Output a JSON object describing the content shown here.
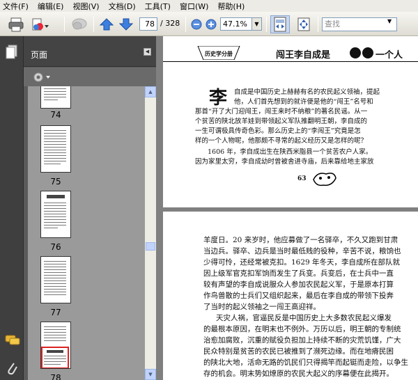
{
  "menu": [
    "文件(F)",
    "编辑(E)",
    "视图(V)",
    "文档(D)",
    "工具(T)",
    "窗口(W)",
    "帮助(H)"
  ],
  "toolbar": {
    "page_current": "78",
    "page_total": "/ 328",
    "zoom": "47.1%",
    "search_placeholder": "查找"
  },
  "panel": {
    "title": "页面",
    "thumb_labels": [
      "74",
      "75",
      "76",
      "77",
      "78"
    ]
  },
  "page1": {
    "header_tag": "历史学分册",
    "header_title": "闯王李自成是",
    "header_title_end": "一个人",
    "dropcap": "李",
    "lines": [
      "自成是中国历史上赫赫有名的农民起义领袖，提起",
      "他，人们首先想到的就许便是他的“闯王”名号和",
      "那首“开了大门迎闯王，闯王来时不纳粮”的著名民谣。从一",
      "个贫苦的陕北放羊娃到带领起义军队推翻明王朝，李自成的",
      "一生可谓极具传奇色彩。那么历史上的“李闯王”究竟是怎",
      "样的一个人物呢，他那颇不寻常的起义经历又是怎样的呢？",
      "1606 年，李自成出生在陕西米脂县一个贫苦农户人家。",
      "因为家里太穷，李自成幼时曾被舍进寺庙，后来靠给地主家放"
    ],
    "page_number": "63"
  },
  "page2": {
    "lines": [
      "羊度日。20 来岁时，他应募做了一名驿卒，不久又跑到甘肃",
      "当边兵。驿卒、边兵是当时最低贱的役种，辛苦不说，粮饷也",
      "少得可怜，还经常被克扣。1629 年冬天，李自成所在部队就",
      "因上级军官克扣军饷而发生了兵变。兵变后，在士兵中一直",
      "较有声望的李自成说服众人参加农民起义军，于是原本打算",
      "作鸟兽散的士兵们又组织起来，最后在李自成的带领下投奔",
      "了当时的起义领袖之一闯王高迎祥。",
      "天灾人祸，官逼民反是中国历史上大多数农民起义爆发",
      "的最根本原因，在明末也不例外。万历以后，明王朝的专制统",
      "治愈加腐败，沉重的赋役负担加上持续不断的灾荒饥馑，广大",
      "民众特别是贫苦的农民已被推到了濒死边缘。而在地瘠民困",
      "的陕北大地，活命无路的饥民们只得揭竿而起铤而走险，以争生",
      "存的机会。明末势如燎原的农民大起义的序幕便在此揭开。"
    ]
  }
}
